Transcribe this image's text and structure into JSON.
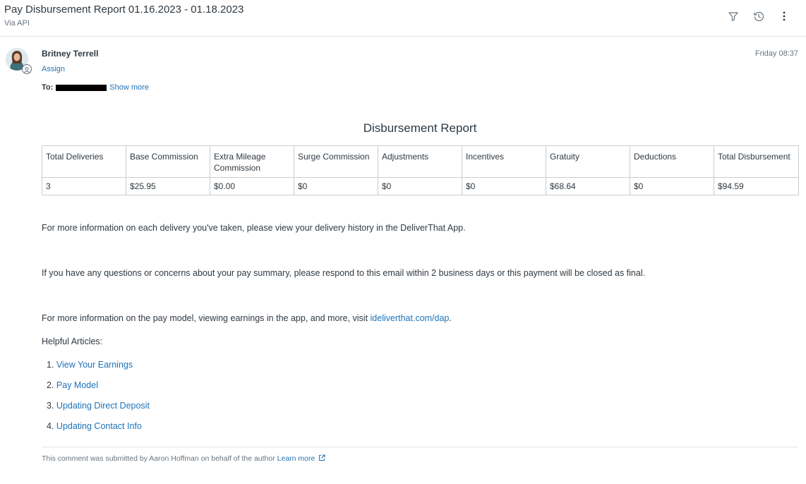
{
  "ticket": {
    "title": "Pay Disbursement Report 01.16.2023 - 01.18.2023",
    "via": "Via API"
  },
  "header_actions": {
    "icons": [
      "filter-icon",
      "history-icon",
      "more-options-icon"
    ]
  },
  "comment": {
    "author": "Britney Terrell",
    "assign_label": "Assign",
    "to_label": "To:",
    "show_more_label": "Show more",
    "timestamp": "Friday 08:37"
  },
  "report": {
    "title": "Disbursement Report",
    "columns": [
      "Total Deliveries",
      "Base Commission",
      "Extra Mileage Commission",
      "Surge Commission",
      "Adjustments",
      "Incentives",
      "Gratuity",
      "Deductions",
      "Total Disbursement"
    ],
    "rows": [
      [
        "3",
        "$25.95",
        "$0.00",
        "$0",
        "$0",
        "$0",
        "$68.64",
        "$0",
        "$94.59"
      ]
    ]
  },
  "body": {
    "p1": "For more information on each delivery you've taken, please view your delivery history in the DeliverThat App.",
    "p2": "If you have any questions or concerns about your pay summary, please respond to this email within 2 business days or this payment will be closed as final.",
    "p3_prefix": "For more information on the pay model, viewing earnings in the app, and more, visit ",
    "p3_link": "ideliverthat.com/dap",
    "p3_suffix": ".",
    "helpful_heading": "Helpful Articles:",
    "articles": [
      {
        "num": "1.",
        "label": "View Your Earnings"
      },
      {
        "num": "2.",
        "label": "Pay Model"
      },
      {
        "num": "3.",
        "label": "Updating Direct Deposit"
      },
      {
        "num": "4.",
        "label": "Updating Contact Info"
      }
    ]
  },
  "footer": {
    "note": "This comment was submitted by Aaron Hoffman on behalf of the author ",
    "learn_more": "Learn more"
  },
  "colors": {
    "text": "#2f3941",
    "muted": "#68737d",
    "link": "#1f73b7",
    "border": "#c8cdd2"
  }
}
